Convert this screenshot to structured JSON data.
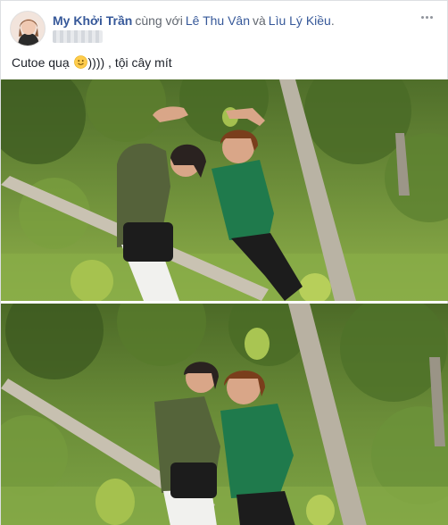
{
  "post": {
    "author": "My Khởi Trần",
    "with_text": "cùng với",
    "tagged": [
      "Lê Thu Vân",
      "Lìu Lý Kiều"
    ],
    "and_text": "và",
    "period": ".",
    "caption_before": "Cutoe quạ",
    "caption_after": ")))) , tội cây mít",
    "emoji": "slightly-smiling-face-icon"
  },
  "colors": {
    "link": "#365899",
    "secondary_text": "#616770",
    "body_text": "#1d2129"
  }
}
